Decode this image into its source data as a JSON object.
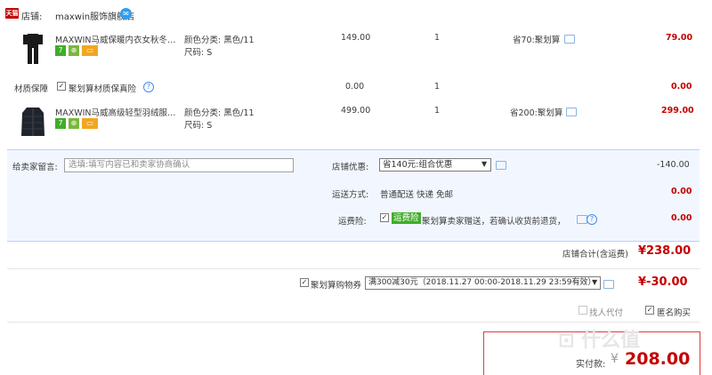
{
  "shop": {
    "badge": "天猫",
    "label": "店铺:",
    "name": "maxwin服饰旗舰店",
    "wangwang_icon": "wangwang-chat-icon"
  },
  "items": [
    {
      "title": "MAXWIN马威保暖内衣女秋冬薄...",
      "color_label": "颜色分类: 黑色/11",
      "size_label": "尺码: S",
      "price": "149.00",
      "qty": "1",
      "saving": "省70:聚划算",
      "total": "79.00",
      "thumb": "thermal-underwear-thumbnail"
    },
    {
      "title": "MAXWIN马威高级轻型羽绒服女...",
      "color_label": "颜色分类: 黑色/11",
      "size_label": "尺码: S",
      "price": "499.00",
      "qty": "1",
      "saving": "省200:聚划算",
      "total": "299.00",
      "thumb": "down-jacket-thumbnail"
    }
  ],
  "insurance": {
    "label": "材质保障",
    "option": "聚划算材质保真险",
    "price": "0.00",
    "qty": "1",
    "total": "0.00"
  },
  "message": {
    "label": "给卖家留言:",
    "placeholder": "选填:填写内容已和卖家协商确认"
  },
  "shop_discount": {
    "label": "店铺优惠:",
    "selected": "省140元:组合优惠",
    "amount": "-140.00"
  },
  "shipping": {
    "label": "运送方式:",
    "value": "普通配送 快递 免邮",
    "amount": "0.00"
  },
  "freight_insurance": {
    "label": "运费险:",
    "tag": "运费险",
    "text": "聚划算卖家赠送，若确认收货前退货，",
    "amount": "0.00"
  },
  "shop_total": {
    "label": "店铺合计(含运费)",
    "amount": "¥238.00"
  },
  "coupon": {
    "label": "聚划算购物券",
    "selected": "满300减30元（2018.11.27 00:00-2018.11.29 23:59有效）",
    "amount": "¥-30.00"
  },
  "options": {
    "proxy_pay": "找人代付",
    "anonymous": "匿名购买"
  },
  "pay": {
    "label": "实付款:",
    "currency": "¥",
    "amount": "208.00"
  },
  "colors": {
    "accent_red": "#c40000",
    "panel_bg": "#f2f7ff",
    "panel_border": "#b2d1ff"
  }
}
